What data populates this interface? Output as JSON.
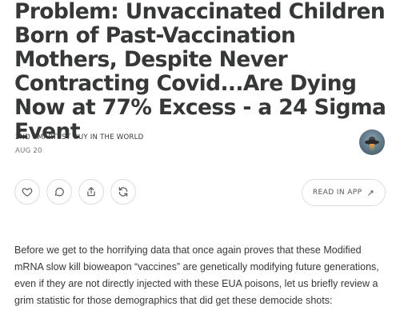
{
  "post": {
    "title": "Problem: Unvaccinated Children Born of Past-Vaccination Mothers, Despite Never Contracting Covid...Are Dying Now at 77% Excess - a 24 Sigma Event",
    "author": "2ND SMARTEST GUY IN THE WORLD",
    "date": "AUG 20",
    "body": "Before we get to the horrifying data that once again proves that these Modified mRNA slow kill bioweapon “vaccines” are genetically modifying future generations, even if they are not directly injected with these EUA poisons, let us briefly review a grim statistic for those demographics that did get these democide shots:"
  },
  "actions": {
    "like_icon": "heart-icon",
    "comment_icon": "comment-icon",
    "share_icon": "share-icon",
    "restack_icon": "restack-icon",
    "read_in_app_label": "READ IN APP",
    "read_in_app_icon": "arrow-up-right-icon"
  },
  "colors": {
    "text": "#363737",
    "muted": "#777777",
    "border": "#dcdcdc"
  }
}
